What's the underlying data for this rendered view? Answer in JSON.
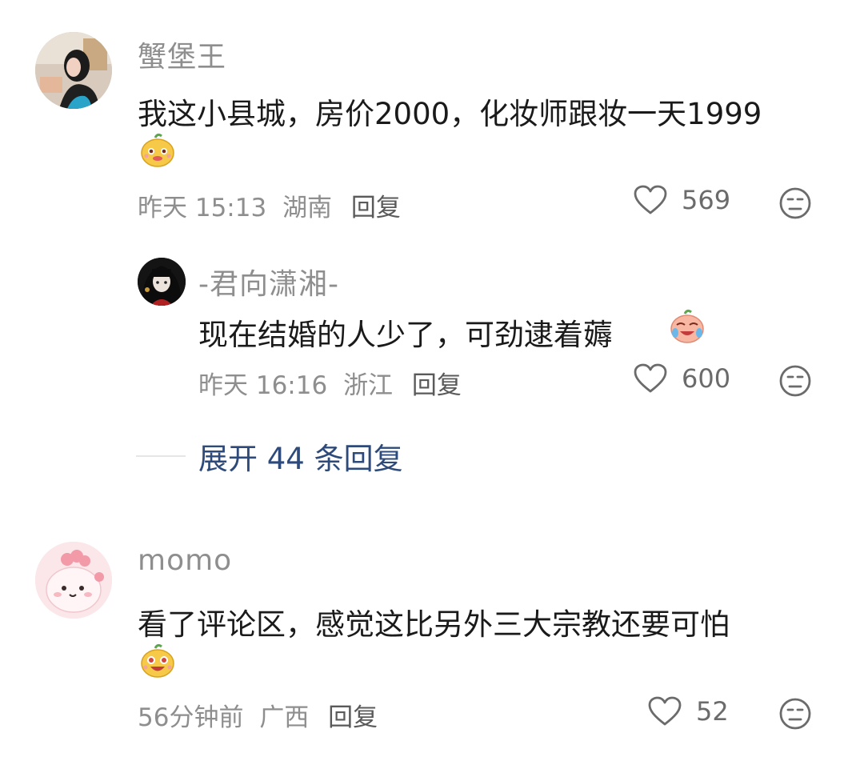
{
  "comments": [
    {
      "username": "蟹堡王",
      "text": "我这小县城，房价2000，化妆师跟妆一天1999",
      "emoji": "smiling-mango-emoji",
      "time": "昨天 15:13",
      "location": "湖南",
      "reply_label": "回复",
      "likes": "569",
      "replies": [
        {
          "username": "-君向潇湘-",
          "text": "现在结婚的人少了，可劲逮着薅",
          "emoji": "crying-laughing-emoji",
          "time": "昨天 16:16",
          "location": "浙江",
          "reply_label": "回复",
          "likes": "600"
        }
      ],
      "expand_label": "展开 44 条回复"
    },
    {
      "username": "momo",
      "text": "看了评论区，感觉这比另外三大宗教还要可怕",
      "emoji": "excited-mango-emoji",
      "time": "56分钟前",
      "location": "广西",
      "reply_label": "回复",
      "likes": "52"
    }
  ],
  "colors": {
    "username": "#8e8e8e",
    "content": "#1a1a1a",
    "expand_link": "#2d4a7a",
    "meta": "#8e8e8e"
  }
}
